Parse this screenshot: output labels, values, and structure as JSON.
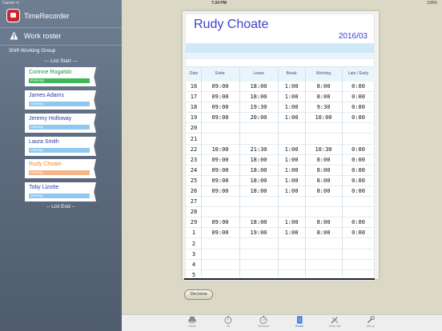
{
  "status_bar": {
    "carrier": "Carrier ᯤ",
    "time": "7:24 PM",
    "battery": "100%"
  },
  "sidebar": {
    "app_title": "TimeRecorder",
    "roster_label": "Work roster",
    "group_label": "Shift Working Group",
    "list_start": "--- List Start ---",
    "list_end": "-- List End --",
    "staff": [
      {
        "name": "Corinne Rogalski",
        "status": "Entering"
      },
      {
        "name": "James Adams",
        "status": "Leaving"
      },
      {
        "name": "Jeremy Holloway",
        "status": "Leaving"
      },
      {
        "name": "Laura Smith",
        "status": "Leaving"
      },
      {
        "name": "Rudy Choate",
        "status": "Leaving"
      },
      {
        "name": "Toby Lizotte",
        "status": "Leaving"
      }
    ]
  },
  "sheet": {
    "staff_name": "Rudy Choate",
    "month": "2016/03",
    "columns": [
      "Date",
      "Enter",
      "Leave",
      "Break",
      "Working",
      "Late / Early"
    ],
    "rows": [
      [
        "16",
        "09:00",
        "18:00",
        "1:00",
        "8:00",
        "0:00"
      ],
      [
        "17",
        "09:00",
        "18:00",
        "1:00",
        "8:00",
        "0:00"
      ],
      [
        "18",
        "09:00",
        "19:30",
        "1:00",
        "9:30",
        "0:00"
      ],
      [
        "19",
        "09:00",
        "20:00",
        "1:00",
        "10:00",
        "0:00"
      ],
      [
        "20",
        "",
        "",
        "",
        "",
        ""
      ],
      [
        "21",
        "",
        "",
        "",
        "",
        ""
      ],
      [
        "22",
        "10:00",
        "21:30",
        "1:00",
        "10:30",
        "0:00"
      ],
      [
        "23",
        "09:00",
        "18:00",
        "1:00",
        "8:00",
        "0:00"
      ],
      [
        "24",
        "09:00",
        "18:00",
        "1:00",
        "8:00",
        "0:00"
      ],
      [
        "25",
        "09:00",
        "18:00",
        "1:00",
        "8:00",
        "0:00"
      ],
      [
        "26",
        "09:00",
        "18:00",
        "1:00",
        "8:00",
        "0:00"
      ],
      [
        "27",
        "",
        "",
        "",
        "",
        ""
      ],
      [
        "28",
        "",
        "",
        "",
        "",
        ""
      ],
      [
        "29",
        "09:00",
        "18:00",
        "1:00",
        "8:00",
        "0:00"
      ],
      [
        "1",
        "09:00",
        "19:00",
        "1:00",
        "8:00",
        "0:00"
      ],
      [
        "2",
        "",
        "",
        "",
        "",
        ""
      ],
      [
        "3",
        "",
        "",
        "",
        "",
        ""
      ],
      [
        "4",
        "",
        "",
        "",
        "",
        ""
      ],
      [
        "5",
        "",
        "",
        "",
        "",
        ""
      ]
    ]
  },
  "decision_label": "Decision",
  "tabs": [
    {
      "label": "Home",
      "icon": "printer-icon"
    },
    {
      "label": "All",
      "icon": "stopwatch-icon"
    },
    {
      "label": "Personal",
      "icon": "stopwatch-person-icon"
    },
    {
      "label": "Roster",
      "icon": "document-icon"
    },
    {
      "label": "Work rule",
      "icon": "tools-icon"
    },
    {
      "label": "Set up",
      "icon": "wrench-icon"
    }
  ],
  "active_tab": "Roster",
  "colors": {
    "accent": "#3b3fd0",
    "entering": "#3fb85a",
    "leaving": "#8ec8f0",
    "selected": "#f28a2a"
  }
}
